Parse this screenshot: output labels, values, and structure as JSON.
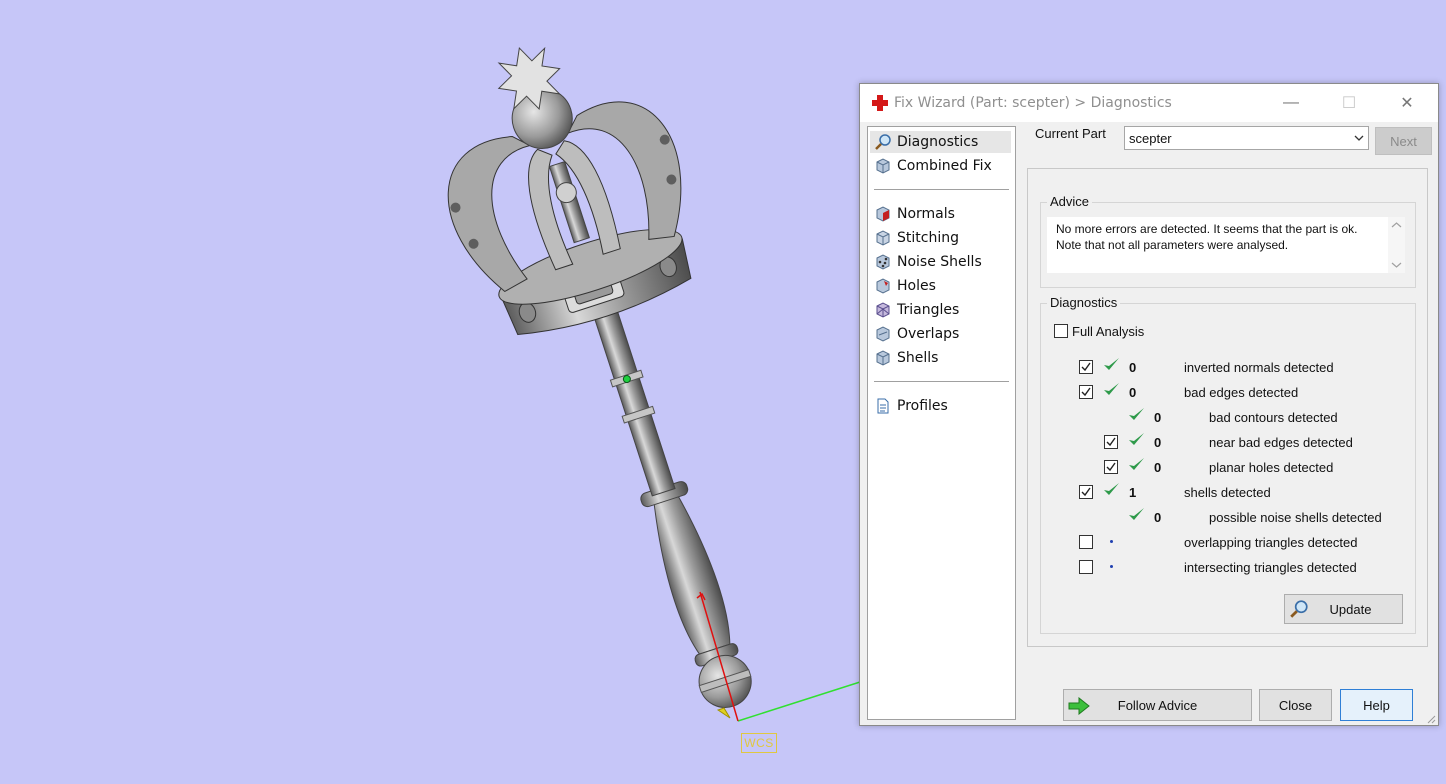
{
  "viewport": {
    "wcs_label": "WCS"
  },
  "window": {
    "title": "Fix Wizard (Part: scepter) > Diagnostics",
    "controls": {
      "minimize": "—",
      "maximize": "☐",
      "close": "✕"
    }
  },
  "sidebar": {
    "items": [
      {
        "label": "Diagnostics",
        "icon": "magnifier-icon",
        "selected": true
      },
      {
        "label": "Combined Fix",
        "icon": "cube-icon"
      },
      {
        "label": "Normals",
        "icon": "normals-cube-icon"
      },
      {
        "label": "Stitching",
        "icon": "stitching-cube-icon"
      },
      {
        "label": "Noise Shells",
        "icon": "noise-shells-icon"
      },
      {
        "label": "Holes",
        "icon": "holes-cube-icon"
      },
      {
        "label": "Triangles",
        "icon": "triangles-cube-icon"
      },
      {
        "label": "Overlaps",
        "icon": "overlaps-cube-icon"
      },
      {
        "label": "Shells",
        "icon": "shells-cube-icon"
      },
      {
        "label": "Profiles",
        "icon": "document-icon"
      }
    ]
  },
  "current_part": {
    "label": "Current Part",
    "value": "scepter"
  },
  "buttons": {
    "next": "Next",
    "update": "Update",
    "follow_advice": "Follow Advice",
    "close": "Close",
    "help": "Help"
  },
  "advice": {
    "title": "Advice",
    "text": "No more errors are detected. It seems that the part is ok. Note that not all parameters were analysed."
  },
  "diagnostics": {
    "title": "Diagnostics",
    "full_analysis_label": "Full Analysis",
    "full_analysis_checked": false,
    "rows": [
      {
        "checkbox": true,
        "checked": true,
        "status": "ok",
        "count": "0",
        "label": "inverted normals detected",
        "indent": 0
      },
      {
        "checkbox": true,
        "checked": true,
        "status": "ok",
        "count": "0",
        "label": "bad edges detected",
        "indent": 0
      },
      {
        "checkbox": false,
        "checked": false,
        "status": "ok",
        "count": "0",
        "label": "bad contours detected",
        "indent": 1
      },
      {
        "checkbox": true,
        "checked": true,
        "status": "ok",
        "count": "0",
        "label": "near bad edges detected",
        "indent": 1
      },
      {
        "checkbox": true,
        "checked": true,
        "status": "ok",
        "count": "0",
        "label": "planar holes detected",
        "indent": 1
      },
      {
        "checkbox": true,
        "checked": true,
        "status": "ok",
        "count": "1",
        "label": "shells detected",
        "indent": 0
      },
      {
        "checkbox": false,
        "checked": false,
        "status": "ok",
        "count": "0",
        "label": "possible noise shells detected",
        "indent": 1
      },
      {
        "checkbox": true,
        "checked": false,
        "status": "pending",
        "count": "",
        "label": "overlapping triangles detected",
        "indent": 0
      },
      {
        "checkbox": true,
        "checked": false,
        "status": "pending",
        "count": "",
        "label": "intersecting triangles detected",
        "indent": 0
      }
    ]
  },
  "colors": {
    "background": "#c6c6f8",
    "check_green": "#2e9a4a",
    "axis_red": "#e01010",
    "axis_green": "#30e030",
    "wcs_yellow": "#e0c840"
  }
}
